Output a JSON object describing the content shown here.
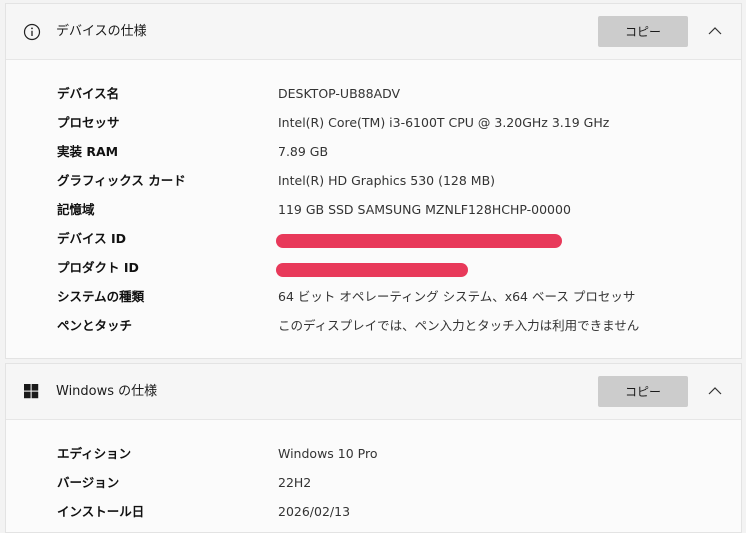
{
  "device_spec": {
    "title": "デバイスの仕様",
    "copy_label": "コピー",
    "icon": "info-icon",
    "rows": [
      {
        "label": "デバイス名",
        "value": "DESKTOP-UB88ADV"
      },
      {
        "label": "プロセッサ",
        "value": "Intel(R) Core(TM) i3-6100T CPU @ 3.20GHz   3.19 GHz"
      },
      {
        "label": "実装 RAM",
        "value": "7.89 GB"
      },
      {
        "label": "グラフィックス カード",
        "value": "Intel(R) HD Graphics 530 (128 MB)"
      },
      {
        "label": "記憶域",
        "value": "119 GB SSD SAMSUNG MZNLF128HCHP-00000"
      },
      {
        "label": "デバイス ID",
        "value": ""
      },
      {
        "label": "プロダクト ID",
        "value": ""
      },
      {
        "label": "システムの種類",
        "value": "64 ビット オペレーティング システム、x64 ベース プロセッサ"
      },
      {
        "label": "ペンとタッチ",
        "value": "このディスプレイでは、ペン入力とタッチ入力は利用できません"
      }
    ]
  },
  "windows_spec": {
    "title": "Windows の仕様",
    "copy_label": "コピー",
    "icon": "windows-logo-icon",
    "rows": [
      {
        "label": "エディション",
        "value": "Windows 10 Pro"
      },
      {
        "label": "バージョン",
        "value": "22H2"
      },
      {
        "label": "インストール日",
        "value": "2026/02/13"
      }
    ]
  },
  "colors": {
    "redaction": "#e8395a",
    "copy_button": "#cccccc"
  }
}
